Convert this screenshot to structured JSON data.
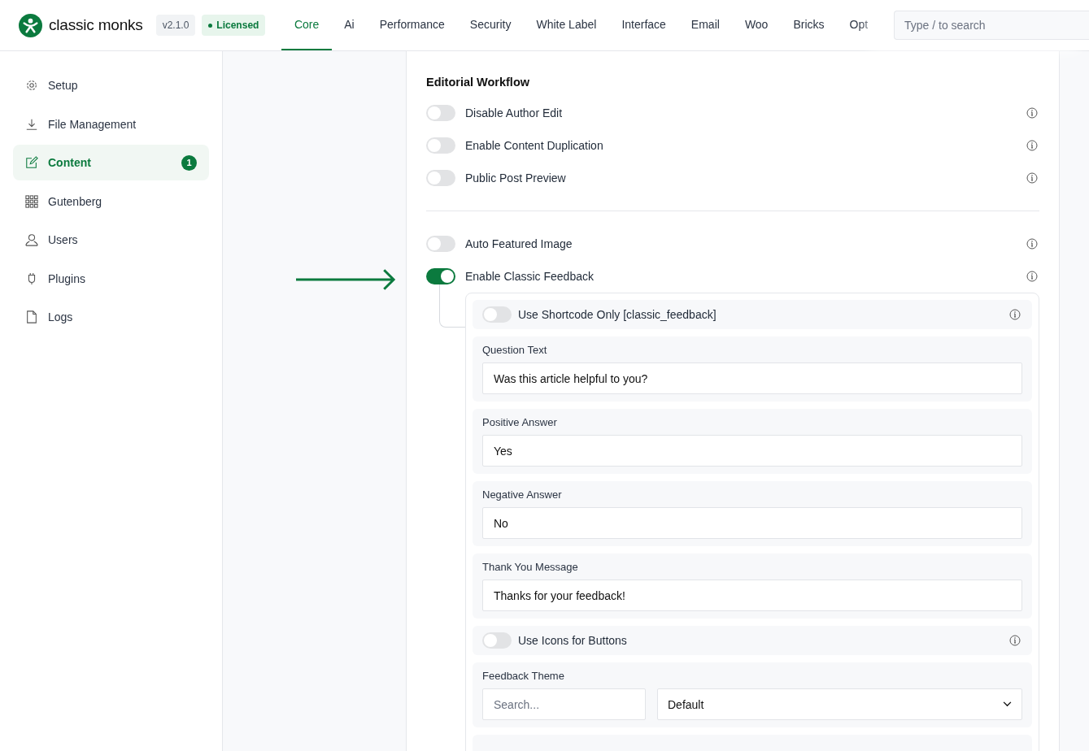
{
  "header": {
    "logo": "classic monks",
    "version": "v2.1.0",
    "license": "Licensed"
  },
  "tabs": [
    {
      "label": "Core",
      "selected": true
    },
    {
      "label": "Ai",
      "selected": false
    },
    {
      "label": "Performance",
      "selected": false
    },
    {
      "label": "Security",
      "selected": false
    },
    {
      "label": "White Label",
      "selected": false
    },
    {
      "label": "Interface",
      "selected": false
    },
    {
      "label": "Email",
      "selected": false
    },
    {
      "label": "Woo",
      "selected": false
    },
    {
      "label": "Bricks",
      "selected": false
    },
    {
      "label": "Opt",
      "selected": false
    }
  ],
  "search": {
    "placeholder": "Type / to search"
  },
  "sidebar": {
    "items": [
      {
        "label": "Setup",
        "selected": false
      },
      {
        "label": "File Management",
        "selected": false
      },
      {
        "label": "Content",
        "selected": true,
        "badge": "1"
      },
      {
        "label": "Gutenberg",
        "selected": false
      },
      {
        "label": "Users",
        "selected": false
      },
      {
        "label": "Plugins",
        "selected": false
      },
      {
        "label": "Logs",
        "selected": false
      }
    ]
  },
  "section": {
    "title": "Editorial Workflow",
    "groups": [
      {
        "rows": [
          {
            "label": "Disable Author Edit",
            "on": false
          },
          {
            "label": "Enable Content Duplication",
            "on": false
          },
          {
            "label": "Public Post Preview",
            "on": false
          }
        ]
      },
      {
        "rows": [
          {
            "label": "Auto Featured Image",
            "on": false
          },
          {
            "label": "Enable Classic Feedback",
            "on": true,
            "children": [
              {
                "kind": "toggle",
                "label": "Use Shortcode Only [classic_feedback]",
                "on": false
              },
              {
                "kind": "text",
                "label": "Question Text",
                "value": "Was this article helpful to you?"
              },
              {
                "kind": "text",
                "label": "Positive Answer",
                "value": "Yes"
              },
              {
                "kind": "text",
                "label": "Negative Answer",
                "value": "No"
              },
              {
                "kind": "text",
                "label": "Thank You Message",
                "value": "Thanks for your feedback!"
              },
              {
                "kind": "toggle",
                "label": "Use Icons for Buttons",
                "on": false
              },
              {
                "kind": "select",
                "label": "Feedback Theme",
                "placeholder": "Search...",
                "value": "Default"
              }
            ]
          }
        ]
      }
    ]
  }
}
